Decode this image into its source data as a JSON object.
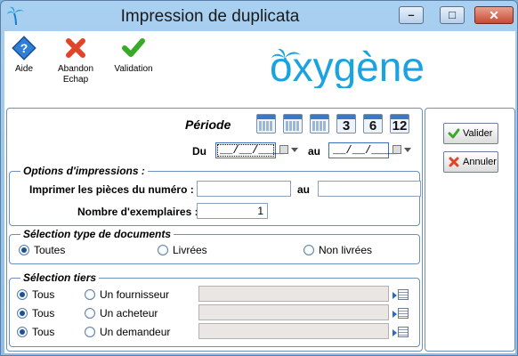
{
  "window": {
    "title": "Impression de duplicata",
    "min_glyph": "–",
    "max_glyph": "□",
    "close_glyph": "✕"
  },
  "toolbar": {
    "help_label": "Aide",
    "abandon_label": "Abandon",
    "abandon_sub": "Echap",
    "validation_label": "Validation"
  },
  "logo": {
    "text": "oxygène",
    "color": "#1aa3e0"
  },
  "periode": {
    "title": "Période",
    "cal_numbers": [
      "3",
      "6",
      "12"
    ],
    "du_label": "Du",
    "au_label": "au",
    "du_value": "__/__/____",
    "au_value": "__/__/____"
  },
  "options": {
    "legend": "Options d'impressions :",
    "pieces_label": "Imprimer les pièces du numéro :",
    "pieces_from": "",
    "pieces_au_label": "au",
    "pieces_to": "",
    "exemplaires_label": "Nombre d'exemplaires :",
    "exemplaires_value": "1"
  },
  "type_documents": {
    "legend": "Sélection type de documents",
    "options": [
      "Toutes",
      "Livrées",
      "Non livrées"
    ],
    "selected": "Toutes"
  },
  "tiers": {
    "legend": "Sélection tiers",
    "rows": [
      {
        "tous_label": "Tous",
        "other_label": "Un fournisseur",
        "value": ""
      },
      {
        "tous_label": "Tous",
        "other_label": "Un acheteur",
        "value": ""
      },
      {
        "tous_label": "Tous",
        "other_label": "Un demandeur",
        "value": ""
      }
    ]
  },
  "side": {
    "valider_label": "Valider",
    "annuler_label": "Annuler"
  },
  "colors": {
    "accent": "#1aa3e0",
    "valid_green": "#3aa829",
    "cancel_red": "#e0452a"
  }
}
